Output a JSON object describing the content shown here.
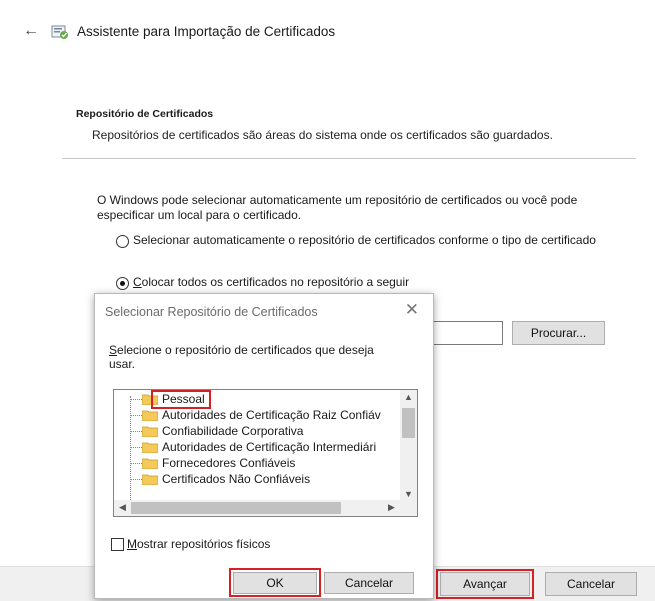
{
  "wizard": {
    "title": "Assistente para Importação de Certificados",
    "section_title": "Repositório de Certificados",
    "section_desc": "Repositórios de certificados são áreas do sistema onde os certificados são guardados.",
    "intro": "O Windows pode selecionar automaticamente um repositório de certificados ou você pode especificar um local para o certificado.",
    "radio_auto_label": "Selecionar automaticamente o repositório de certificados conforme o tipo de certificado",
    "radio_manual_label": "Colocar todos os certificados no repositório a seguir",
    "store_value": "",
    "browse_label": "Procurar...",
    "next_label": "Avançar",
    "cancel_label": "Cancelar"
  },
  "dialog": {
    "title": "Selecionar Repositório de Certificados",
    "close_glyph": "✕",
    "prompt": "Selecione o repositório de certificados que deseja usar.",
    "stores": [
      "Pessoal",
      "Autoridades de Certificação Raiz Confiáv",
      "Confiabilidade Corporativa",
      "Autoridades de Certificação Intermediári",
      "Fornecedores Confiáveis",
      "Certificados Não Confiáveis"
    ],
    "show_physical_label": "Mostrar repositórios físicos",
    "ok_label": "OK",
    "cancel_label": "Cancelar"
  },
  "icons": {
    "back": "←",
    "scroll_up": "▲",
    "scroll_down": "▼",
    "scroll_left": "◀",
    "scroll_right": "▶"
  },
  "colors": {
    "highlight": "#d81f26",
    "folder": "#f3c95a",
    "button_face": "#e1e1e1"
  }
}
